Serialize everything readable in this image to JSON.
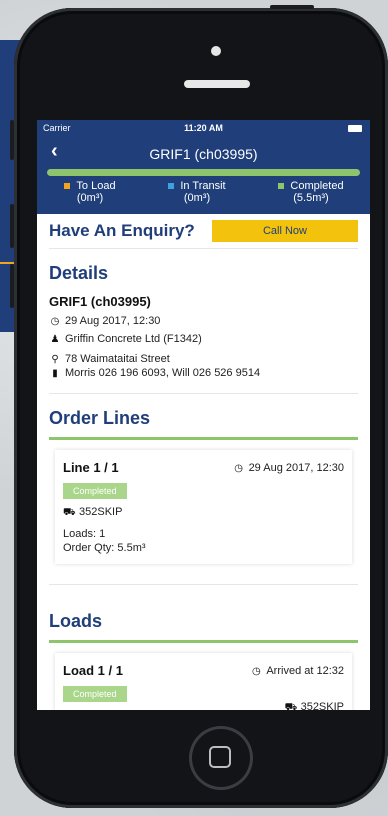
{
  "status_bar": {
    "carrier": "Carrier",
    "time": "11:20 AM"
  },
  "header": {
    "back_icon": "chevron-left-icon",
    "title": "GRIF1 (ch03995)",
    "legend": [
      {
        "label": "To Load",
        "value": "(0m³)",
        "color": "#f2a31f"
      },
      {
        "label": "In Transit",
        "value": "(0m³)",
        "color": "#3fa0e0"
      },
      {
        "label": "Completed",
        "value": "(5.5m³)",
        "color": "#8ec46b"
      }
    ],
    "progress_completed_fraction": 1.0
  },
  "enquiry": {
    "title": "Have An Enquiry?",
    "call_button": "Call Now"
  },
  "details": {
    "section_title": "Details",
    "name": "GRIF1 (ch03995)",
    "date": "29 Aug 2017, 12:30",
    "company": "Griffin Concrete Ltd (F1342)",
    "address": "78 Waimataitai Street",
    "contacts": "Morris 026 196 6093, Will 026 526 9514"
  },
  "order_lines": {
    "section_title": "Order Lines",
    "card": {
      "title": "Line 1 / 1",
      "date": "29 Aug 2017, 12:30",
      "status": "Completed",
      "vehicle": "352SKIP",
      "loads": "Loads: 1",
      "order_qty": "Order Qty: 5.5m³"
    }
  },
  "loads": {
    "section_title": "Loads",
    "card": {
      "title": "Load 1 / 1",
      "arrived": "Arrived at 12:32",
      "status": "Completed",
      "vehicle": "352SKIP"
    }
  }
}
